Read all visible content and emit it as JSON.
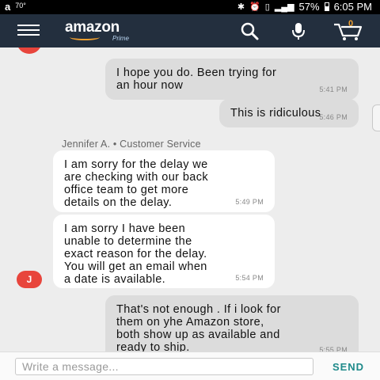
{
  "status_bar": {
    "amazon_glyph": "a",
    "temperature": "70°",
    "battery": "57%",
    "time": "6:05 PM",
    "battery_level": 0.57
  },
  "nav": {
    "logo": "amazon",
    "logo_sub": "Prime",
    "cart_count": "0",
    "brand_color": "#232f3e",
    "accent_color": "#f0a030"
  },
  "chat": {
    "sender_label": "Jennifer A. • Customer Service",
    "avatar_initial": "J",
    "messages": [
      {
        "side": "out",
        "text": "I hope you do. Been trying for\nan hour now",
        "time": "5:41 PM"
      },
      {
        "side": "out",
        "text": "This is ridiculous",
        "time": "5:46 PM"
      },
      {
        "side": "in",
        "text": "I am sorry for the delay we\nare checking with our back\noffice team to get more\ndetails on the delay.",
        "time": "5:49 PM"
      },
      {
        "side": "in",
        "text": "I am sorry I have been\nunable to determine the\nexact reason for the delay.\nYou will get an email when\na date is available.",
        "time": "5:54 PM"
      },
      {
        "side": "out",
        "text": "That's not enough . If i look for\nthem on yhe Amazon store,\nboth show up as available and\nready to ship.",
        "time": "5:55 PM"
      }
    ]
  },
  "composer": {
    "placeholder": "Write a message...",
    "value": "",
    "send_label": "SEND"
  }
}
